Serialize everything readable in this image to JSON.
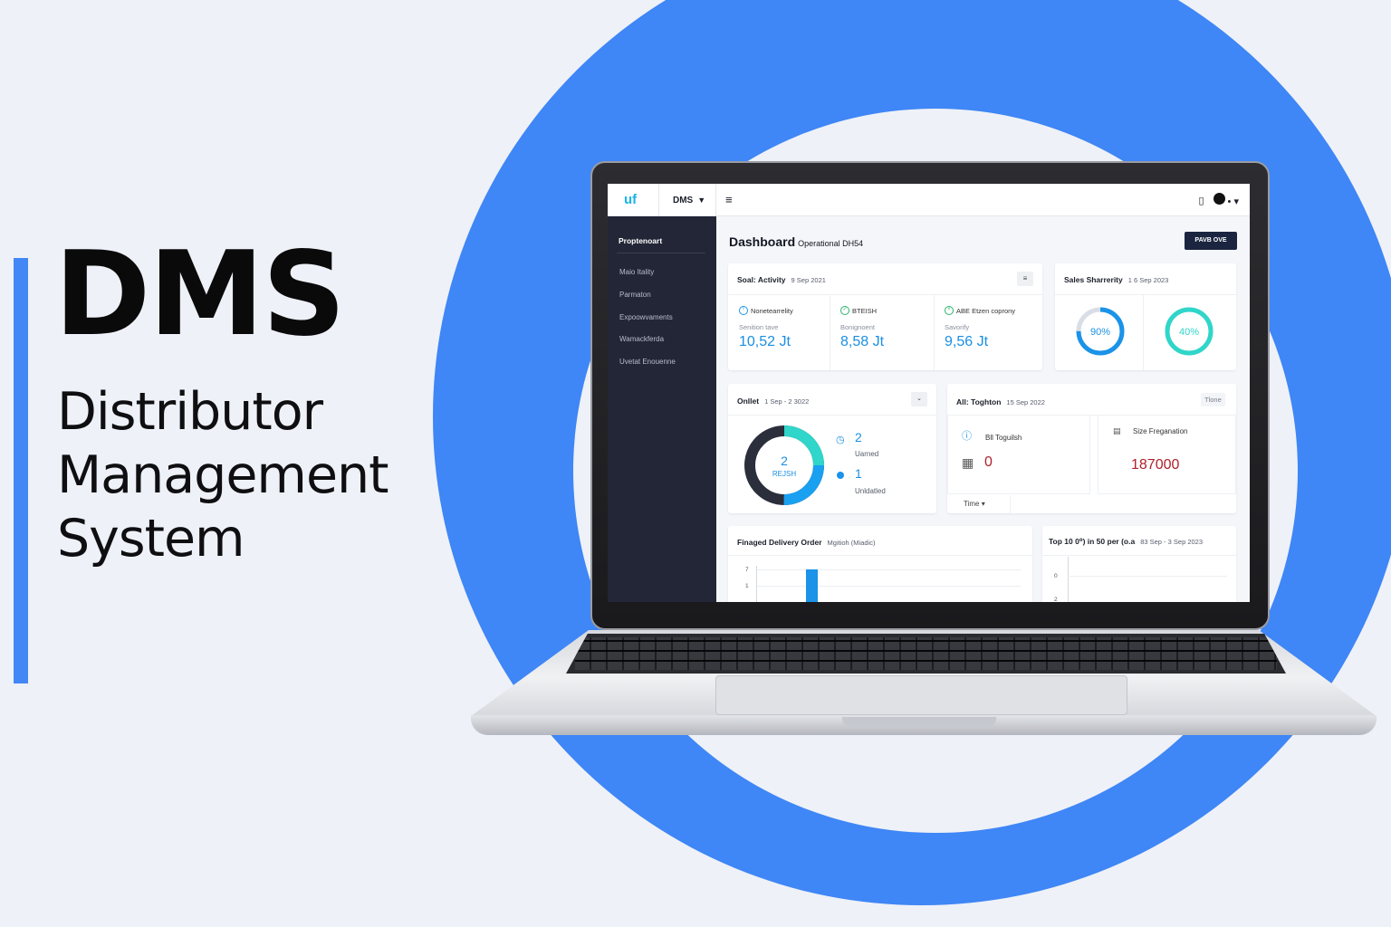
{
  "hero": {
    "title": "DMS",
    "subtitle_line1": "Distributor",
    "subtitle_line2": "Management",
    "subtitle_line3": "System"
  },
  "colors": {
    "accent": "#3f86f6",
    "sidebar": "#232636",
    "value_blue": "#1a8fe3",
    "teal": "#2fd6c9",
    "alert_red": "#b0202a"
  },
  "app": {
    "logo": "uf",
    "brand_select": "DMS",
    "icons": [
      "menu-icon",
      "clipboard-icon",
      "user-avatar-icon",
      "chevron-down-icon"
    ]
  },
  "sidebar": {
    "heading": "Proptenoart",
    "items": [
      "Maio Itality",
      "Parmaton",
      "Expoowvaments",
      "Wamackferda",
      "Uvetat Enouenne"
    ]
  },
  "page": {
    "title": "Dashboard",
    "subtitle": "Operational DH54",
    "action_button": "PAVB OVE"
  },
  "activity_card": {
    "title": "Soal: Activity",
    "date": "9 Sep 2021",
    "menu_label": "≡",
    "metrics": [
      {
        "label": "Nonetearrelity",
        "sub": "Senition tave",
        "value": "10,52 Jt"
      },
      {
        "label": "BTEISH",
        "sub": "Bonignoent",
        "value": "8,58 Jt"
      },
      {
        "label": "ABE Etzen coprony",
        "sub": "Savorify",
        "value": "9,56 Jt"
      }
    ]
  },
  "sales_card": {
    "title": "Sales Sharrerity",
    "date": "1 6 Sep 2023",
    "gauges": [
      {
        "label": "90%",
        "fraction": 0.75,
        "color": "#1a93e8"
      },
      {
        "label": "40%",
        "fraction": 1.0,
        "color": "#2fd6c9"
      }
    ]
  },
  "onllet_card": {
    "title": "Onllet",
    "date": "1 Sep - 2 3022",
    "donut_value": "2",
    "donut_label": "REJSH",
    "legend": [
      {
        "value": "2",
        "label": "Uarned"
      },
      {
        "value": "1",
        "label": "Unldatled"
      }
    ]
  },
  "toghton_card": {
    "title": "All: Toghton",
    "date": "15 Sep 2022",
    "tag": "Tlone",
    "left_label": "Bll Toguilsh",
    "left_value": "0",
    "right_label": "Size Freganation",
    "right_value": "187000",
    "footer": "Time"
  },
  "delivery_card": {
    "title": "Finaged Delivery Order",
    "subtitle": "Mgitioh (Miadic)"
  },
  "top_card": {
    "title": "Top 10 0⁰) in 50 per (o.a",
    "date": "83 Sep - 3 Sep 2023"
  },
  "chart_data": [
    {
      "type": "bar",
      "title": "Finaged Delivery Order",
      "tick_labels": [
        "7",
        "1"
      ],
      "values": [
        7
      ]
    },
    {
      "type": "line",
      "title": "Top 10 0⁰) in 50 per (o.a",
      "tick_labels": [
        "0",
        "2"
      ]
    }
  ]
}
